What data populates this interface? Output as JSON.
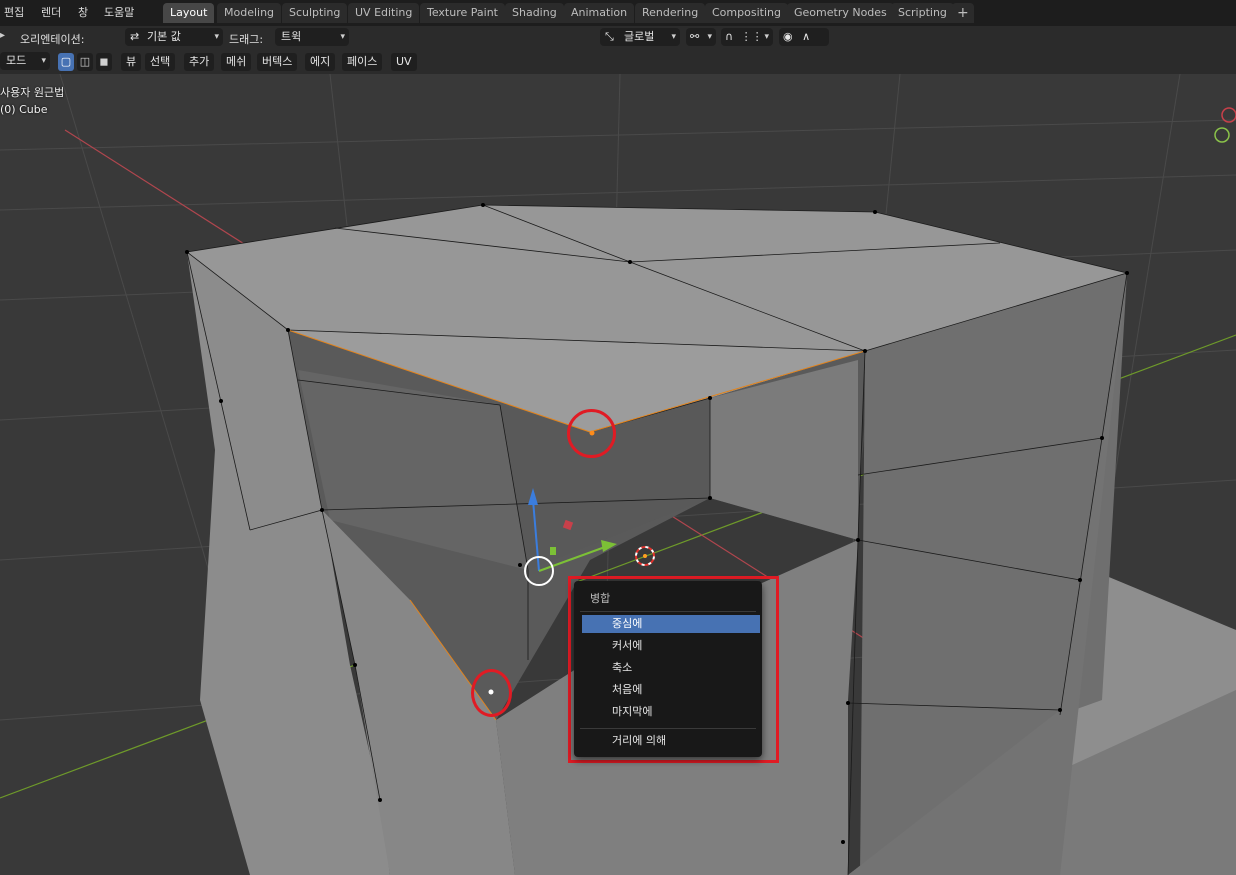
{
  "menubar": {
    "items": [
      "편집",
      "렌더",
      "창",
      "도움말"
    ]
  },
  "workspaces": {
    "tabs": [
      "Layout",
      "Modeling",
      "Sculpting",
      "UV Editing",
      "Texture Paint",
      "Shading",
      "Animation",
      "Rendering",
      "Compositing",
      "Geometry Nodes",
      "Scripting"
    ],
    "active": "Layout",
    "add_label": "+"
  },
  "tool_header": {
    "orientation_label": "오리엔테이션:",
    "orientation_value": "기본 값",
    "drag_label": "드래그:",
    "drag_value": "트윅",
    "transform_orientation": "글로벌"
  },
  "editor_header": {
    "mode_label": "모드",
    "menus": [
      "뷰",
      "선택",
      "추가",
      "메쉬",
      "버텍스",
      "에지",
      "페이스",
      "UV"
    ]
  },
  "viewport": {
    "view_name": "사용자 원근법",
    "object_info": "(0) Cube"
  },
  "merge_menu": {
    "title": "병합",
    "options": [
      "중심에",
      "커서에",
      "축소",
      "처음에",
      "마지막에"
    ],
    "extra_option": "거리에 의해",
    "highlighted_index": 0
  },
  "colors": {
    "accent": "#4772b3",
    "highlight_red": "#e01b24",
    "x_axis": "#b0464e",
    "y_axis": "#6e9a2a"
  }
}
